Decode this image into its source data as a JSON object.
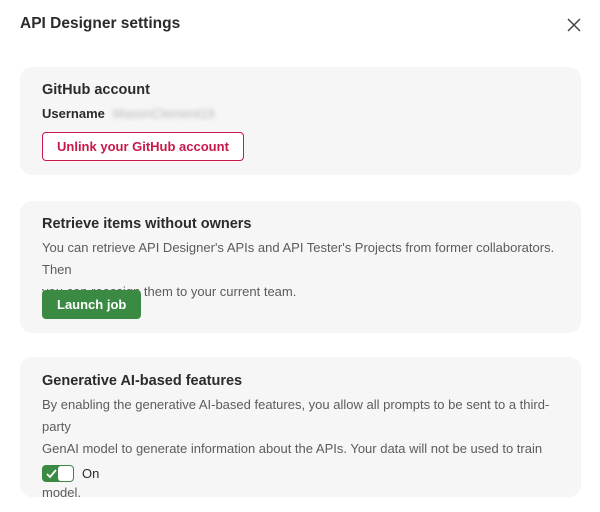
{
  "dialog": {
    "title": "API Designer settings",
    "close_icon": "close-icon"
  },
  "github": {
    "title": "GitHub account",
    "username_label": "Username",
    "username_value": "MasonClement19",
    "unlink_label": "Unlink your GitHub account"
  },
  "retrieve": {
    "title": "Retrieve items without owners",
    "description_line1": "You can retrieve API Designer's APIs and API Tester's Projects from former collaborators. Then",
    "description_line2": "you can reassign them to your current team.",
    "launch_label": "Launch job"
  },
  "ai": {
    "title": "Generative AI-based features",
    "description_line1": "By enabling the generative AI-based features, you allow all prompts to be sent to a third-party",
    "description_line2": "GenAI model to generate information about the APIs. Your data will not be used to train the",
    "description_line3": "model.",
    "toggle_state": "On",
    "toggle_icon": "checkmark-icon"
  },
  "colors": {
    "accent_green": "#3b8a43",
    "danger": "#c9184a",
    "card_bg": "#f6f6f6"
  }
}
